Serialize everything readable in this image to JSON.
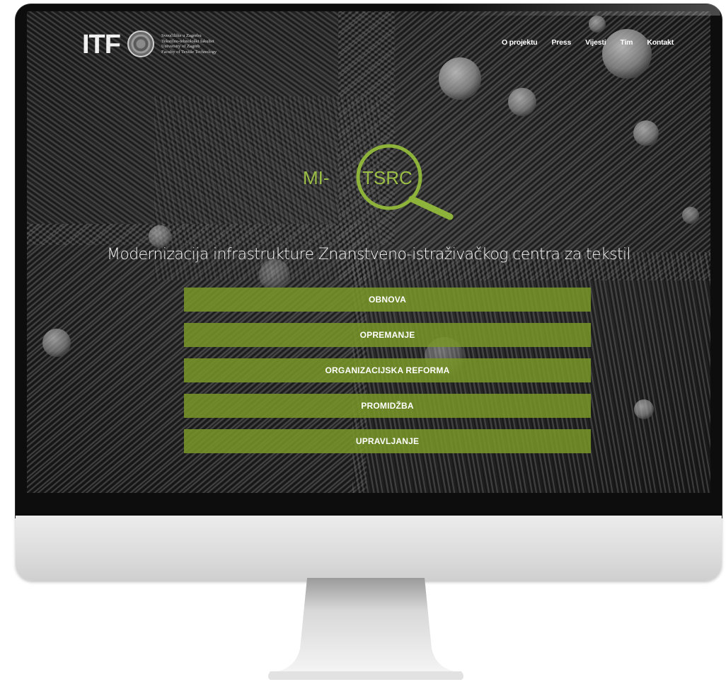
{
  "header": {
    "logo_text": "ITF",
    "university_lines": [
      "Sveučilište u Zagrebu",
      "Tekstilno-tehnološki fakultet",
      "University of Zagreb",
      "Faculty of Textile Technology"
    ]
  },
  "nav": {
    "items": [
      "O projektu",
      "Press",
      "Vijesti",
      "Tim",
      "Kontakt"
    ]
  },
  "hero": {
    "logo_prefix": "MI-",
    "logo_main": "TSRC",
    "title": "Modernizacija infrastrukture Znanstveno-istraživačkog centra za tekstil"
  },
  "buttons": [
    "OBNOVA",
    "OPREMANJE",
    "ORGANIZACIJSKA REFORMA",
    "PROMIDŽBA",
    "UPRAVLJANJE"
  ],
  "colors": {
    "accent_green": "#7c9a2c",
    "logo_green": "#8db33a",
    "text_white": "#ffffff"
  },
  "icons": {
    "hero": "magnifying-glass-icon",
    "seal": "university-seal-icon"
  }
}
